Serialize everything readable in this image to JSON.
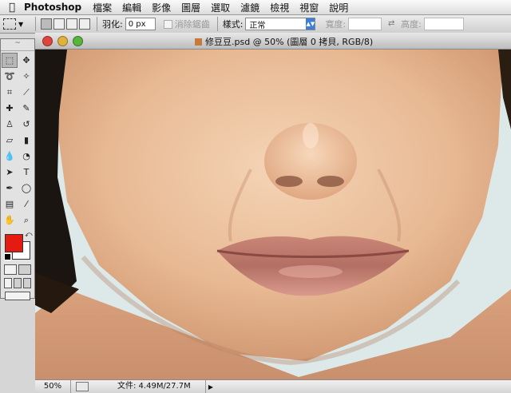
{
  "menubar": {
    "app_name": "Photoshop",
    "menus": [
      "檔案",
      "編輯",
      "影像",
      "圖層",
      "選取",
      "濾鏡",
      "檢視",
      "視窗",
      "說明"
    ]
  },
  "options_bar": {
    "feather_label": "羽化:",
    "feather_value": "0 px",
    "antialias_label": "消除鋸齒",
    "style_label": "樣式:",
    "style_value": "正常",
    "width_label": "寬度:",
    "height_label": "高度:"
  },
  "document": {
    "title": "修豆豆.psd @ 50% (圖層 0 拷貝, RGB/8)",
    "zoom": "50%",
    "doc_info": "文件: 4.49M/27.7M"
  },
  "colors": {
    "foreground": "#e51b12",
    "background": "#ffffff"
  },
  "tools": [
    {
      "name": "marquee",
      "glyph": "⬚"
    },
    {
      "name": "move",
      "glyph": "✥"
    },
    {
      "name": "lasso",
      "glyph": "➰"
    },
    {
      "name": "magic-wand",
      "glyph": "✧"
    },
    {
      "name": "crop",
      "glyph": "⌗"
    },
    {
      "name": "slice",
      "glyph": "⟋"
    },
    {
      "name": "healing-brush",
      "glyph": "✚"
    },
    {
      "name": "brush",
      "glyph": "✎"
    },
    {
      "name": "clone-stamp",
      "glyph": "♙"
    },
    {
      "name": "history-brush",
      "glyph": "↺"
    },
    {
      "name": "eraser",
      "glyph": "▱"
    },
    {
      "name": "gradient",
      "glyph": "▮"
    },
    {
      "name": "blur",
      "glyph": "💧"
    },
    {
      "name": "dodge",
      "glyph": "◔"
    },
    {
      "name": "path-selection",
      "glyph": "➤"
    },
    {
      "name": "type",
      "glyph": "T"
    },
    {
      "name": "pen",
      "glyph": "✒"
    },
    {
      "name": "shape",
      "glyph": "◯"
    },
    {
      "name": "notes",
      "glyph": "▤"
    },
    {
      "name": "eyedropper",
      "glyph": "⁄"
    },
    {
      "name": "hand",
      "glyph": "✋"
    },
    {
      "name": "zoom",
      "glyph": "⌕"
    }
  ]
}
